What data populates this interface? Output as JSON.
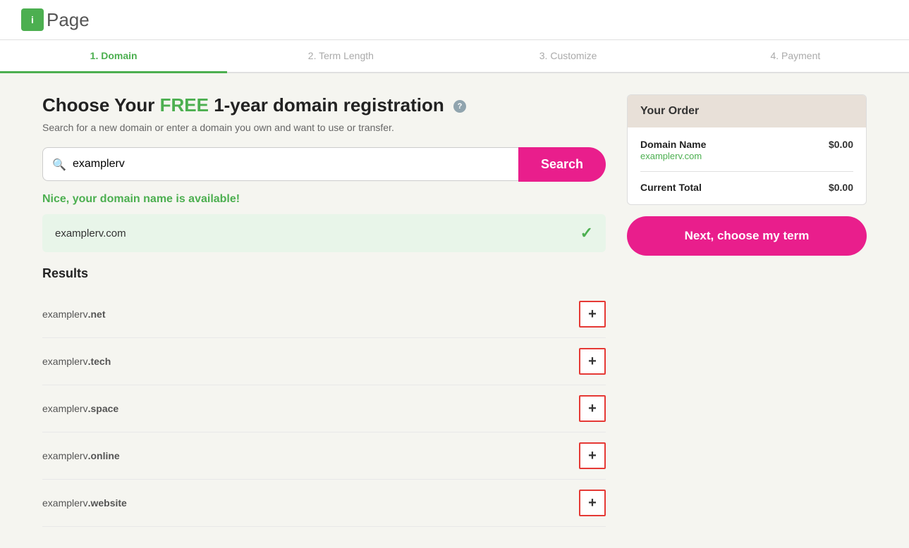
{
  "logo": {
    "icon_text": "i",
    "text": "Page"
  },
  "steps": [
    {
      "label": "1. Domain",
      "active": true
    },
    {
      "label": "2. Term Length",
      "active": false
    },
    {
      "label": "3. Customize",
      "active": false
    },
    {
      "label": "4. Payment",
      "active": false
    }
  ],
  "page": {
    "title_before": "Choose Your ",
    "title_free": "FREE",
    "title_after": " 1-year domain registration",
    "subtitle": "Search for a new domain or enter a domain you own and want to use or transfer.",
    "search_placeholder": "examplerv",
    "search_value": "examplerv",
    "search_button": "Search",
    "available_message": "Nice, your domain name is available!",
    "selected_domain": "examplerv.com",
    "results_title": "Results",
    "results": [
      {
        "base": "examplerv",
        "ext": ".net"
      },
      {
        "base": "examplerv",
        "ext": ".tech"
      },
      {
        "base": "examplerv",
        "ext": ".space"
      },
      {
        "base": "examplerv",
        "ext": ".online"
      },
      {
        "base": "examplerv",
        "ext": ".website"
      }
    ]
  },
  "order": {
    "title": "Your Order",
    "domain_label": "Domain Name",
    "domain_name": "examplerv.com",
    "domain_price": "$0.00",
    "total_label": "Current Total",
    "total_price": "$0.00",
    "next_button": "Next, choose my term"
  },
  "icons": {
    "search": "🔍",
    "check": "✓",
    "plus": "+"
  }
}
